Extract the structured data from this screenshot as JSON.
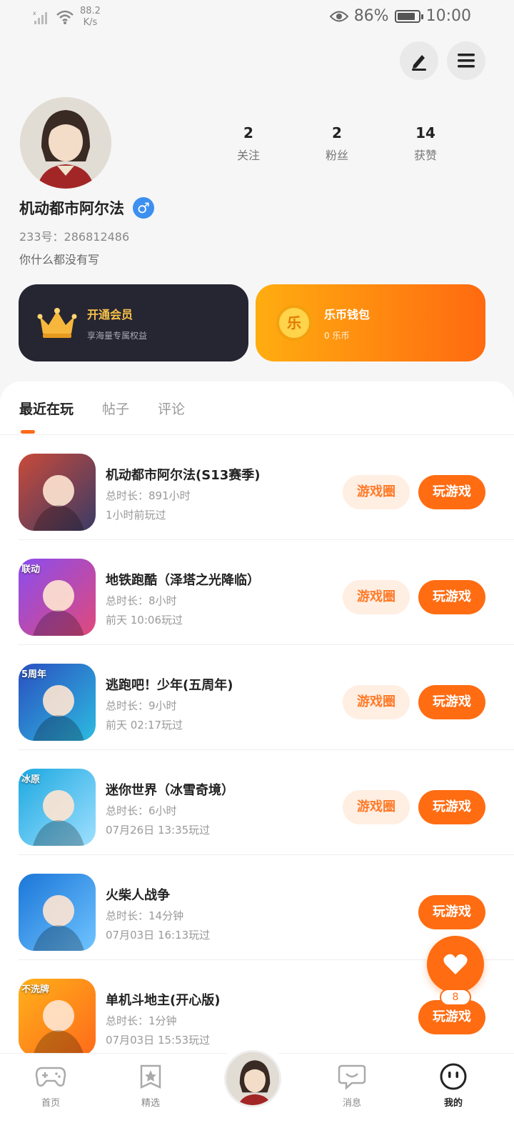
{
  "status_bar": {
    "speed_value": "88.2",
    "speed_unit": "K/s",
    "battery_pct": "86%",
    "battery_level": 0.86,
    "time": "10:00"
  },
  "profile": {
    "stats": [
      {
        "value": "2",
        "label": "关注"
      },
      {
        "value": "2",
        "label": "粉丝"
      },
      {
        "value": "14",
        "label": "获赞"
      }
    ],
    "nickname": "机动都市阿尔法",
    "gender_symbol": "♂",
    "uid": "233号：286812486",
    "bio": "你什么都没有写"
  },
  "cards": {
    "vip": {
      "title": "开通会员",
      "subtitle": "享海量专属权益"
    },
    "wallet": {
      "title": "乐币钱包",
      "subtitle": "0 乐币",
      "coin_glyph": "乐"
    }
  },
  "tabs": [
    "最近在玩",
    "帖子",
    "评论"
  ],
  "games": [
    {
      "name": "机动都市阿尔法(S13赛季)",
      "duration": "总时长：891小时",
      "last_played": "1小时前玩过",
      "circle_label": "游戏圈",
      "play_label": "玩游戏",
      "colors": [
        "#c94a3a",
        "#3b3b66"
      ]
    },
    {
      "name": "地铁跑酷（泽塔之光降临）",
      "duration": "总时长：8小时",
      "last_played": "前天 10:06玩过",
      "circle_label": "游戏圈",
      "play_label": "玩游戏",
      "colors": [
        "#8a4cf0",
        "#e04a7a"
      ],
      "badge": "联动"
    },
    {
      "name": "逃跑吧！少年(五周年)",
      "duration": "总时长：9小时",
      "last_played": "前天 02:17玩过",
      "circle_label": "游戏圈",
      "play_label": "玩游戏",
      "colors": [
        "#2a4fc0",
        "#2dbbe0"
      ],
      "badge": "5周年"
    },
    {
      "name": "迷你世界（冰雪奇境）",
      "duration": "总时长：6小时",
      "last_played": "07月26日 13:35玩过",
      "circle_label": "游戏圈",
      "play_label": "玩游戏",
      "colors": [
        "#1ca8e0",
        "#9fe0ff"
      ],
      "badge": "冰原"
    },
    {
      "name": "火柴人战争",
      "duration": "总时长：14分钟",
      "last_played": "07月03日 16:13玩过",
      "circle_label": "",
      "play_label": "玩游戏",
      "colors": [
        "#1b76d8",
        "#6fc4ff"
      ]
    },
    {
      "name": "单机斗地主(开心版)",
      "duration": "总时长：1分钟",
      "last_played": "07月03日 15:53玩过",
      "circle_label": "",
      "play_label": "玩游戏",
      "colors": [
        "#ffb11a",
        "#ff6a1a"
      ],
      "badge": "不洗牌"
    }
  ],
  "fab": {
    "count": "8"
  },
  "nav": [
    {
      "label": "首页",
      "icon": "gamepad-icon"
    },
    {
      "label": "精选",
      "icon": "star-bookmark-icon"
    },
    {
      "label": "",
      "icon": "avatar"
    },
    {
      "label": "消息",
      "icon": "chat-icon"
    },
    {
      "label": "我的",
      "icon": "face-icon",
      "active": true
    }
  ],
  "colors": {
    "accent": "#ff6c12",
    "vip_bg": "#262532",
    "vip_title": "#f8c24a"
  }
}
